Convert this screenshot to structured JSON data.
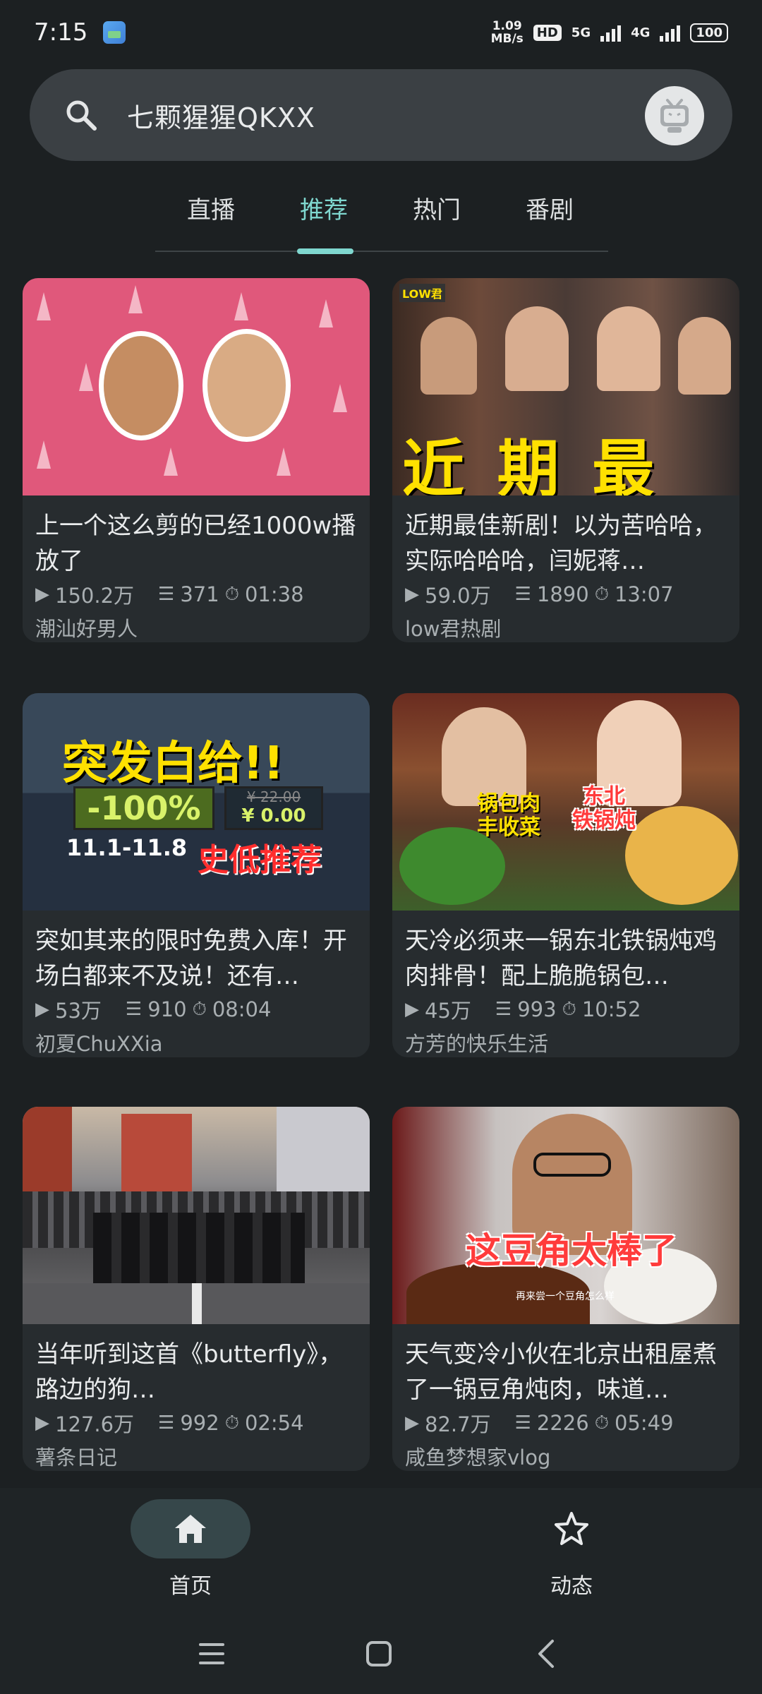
{
  "status_bar": {
    "time": "7:15",
    "net_speed_value": "1.09",
    "net_speed_unit": "MB/s",
    "hd_badge": "HD",
    "net_5g": "5G",
    "net_4g": "4G",
    "battery": "100"
  },
  "search": {
    "text": "七颗猩猩QKXX"
  },
  "tabs": [
    {
      "label": "直播"
    },
    {
      "label": "推荐"
    },
    {
      "label": "热门"
    },
    {
      "label": "番剧"
    }
  ],
  "active_tab": "推荐",
  "videos": [
    {
      "title": "上一个这么剪的已经1000w播放了",
      "views": "150.2万",
      "danmaku": "371",
      "duration": "01:38",
      "author": "潮汕好男人"
    },
    {
      "title": "近期最佳新剧！以为苦哈哈，实际哈哈哈，闫妮蒋…",
      "views": "59.0万",
      "danmaku": "1890",
      "duration": "13:07",
      "author": "low君热剧",
      "thumb_text": "近 期 最 佳",
      "thumb_logo": "LOW君"
    },
    {
      "title": "突如其来的限时免费入库！开场白都来不及说！还有…",
      "views": "53万",
      "danmaku": "910",
      "duration": "08:04",
      "author": "初夏ChuXXia",
      "thumb_headline": "突发白给!!",
      "thumb_discount": "-100%",
      "thumb_old_price": "¥ 22.00",
      "thumb_new_price": "¥ 0.00",
      "thumb_dates": "11.1-11.8",
      "thumb_tag": "史低推荐"
    },
    {
      "title": "天冷必须来一锅东北铁锅炖鸡肉排骨！配上脆脆锅包…",
      "views": "45万",
      "danmaku": "993",
      "duration": "10:52",
      "author": "方芳的快乐生活",
      "thumb_label1_line1": "锅包肉",
      "thumb_label1_line2": "丰收菜",
      "thumb_label2_line1": "东北",
      "thumb_label2_line2": "铁锅炖"
    },
    {
      "title": "当年听到这首《butterfly》，路边的狗…",
      "views": "127.6万",
      "danmaku": "992",
      "duration": "02:54",
      "author": "薯条日记"
    },
    {
      "title": "天气变冷小伙在北京出租屋煮了一锅豆角炖肉，味道…",
      "views": "82.7万",
      "danmaku": "2226",
      "duration": "05:49",
      "author": "咸鱼梦想家vlog",
      "thumb_text": "这豆角太棒了",
      "thumb_subtitle": "再来尝一个豆角怎么样"
    }
  ],
  "bottom_nav": [
    {
      "label": "首页"
    },
    {
      "label": "动态"
    }
  ],
  "colors": {
    "background": "#1c2022",
    "card": "#272c2f",
    "accent": "#7fd7cf",
    "muted_text": "#a9afb2"
  }
}
